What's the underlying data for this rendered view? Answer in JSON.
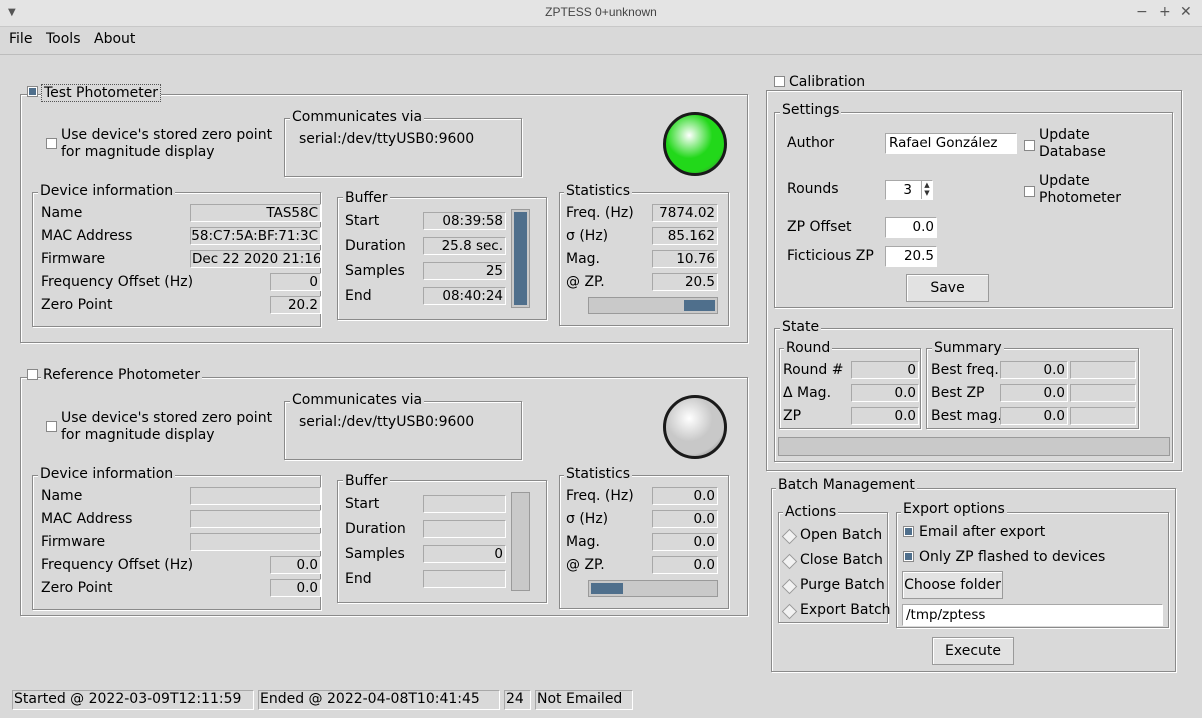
{
  "window": {
    "title": "ZPTESS 0+unknown",
    "controls": [
      "−",
      "+",
      "✕"
    ]
  },
  "menu": {
    "file": "File",
    "tools": "Tools",
    "about": "About"
  },
  "test": {
    "title": "Test Photometer",
    "use_zp_line1": "Use device's stored zero point",
    "use_zp_line2": "for magnitude display",
    "comm_title": "Communicates via",
    "comm_value": "serial:/dev/ttyUSB0:9600",
    "led_color": "#22d81a",
    "devinfo": {
      "title": "Device information",
      "name_label": "Name",
      "name": "TAS58C",
      "mac_label": "MAC Address",
      "mac": "58:C7:5A:BF:71:3C",
      "fw_label": "Firmware",
      "fw": "Dec 22 2020  21:16:",
      "freq_label": "Frequency Offset (Hz)",
      "freq_offset": "0",
      "zp_label": "Zero Point",
      "zp": "20.2"
    },
    "buffer": {
      "title": "Buffer",
      "start_label": "Start",
      "start": "08:39:58",
      "duration_label": "Duration",
      "duration": "25.8 sec.",
      "samples_label": "Samples",
      "samples": "25",
      "end_label": "End",
      "end": "08:40:24",
      "fill": 1.0
    },
    "stats": {
      "title": "Statistics",
      "freq_label": "Freq. (Hz)",
      "freq": "7874.02",
      "sigma_label": "σ (Hz)",
      "sigma": "85.162",
      "mag_label": "Mag.",
      "mag": "10.76",
      "zp_label": "@ ZP.",
      "zp": "20.5",
      "progress": 0.25
    }
  },
  "ref": {
    "title": "Reference Photometer",
    "use_zp_line1": "Use device's stored zero point",
    "use_zp_line2": "for magnitude display",
    "comm_title": "Communicates via",
    "comm_value": "serial:/dev/ttyUSB0:9600",
    "led_color": "#c8c8c8",
    "devinfo": {
      "title": "Device information",
      "name_label": "Name",
      "name": "",
      "mac_label": "MAC Address",
      "mac": "",
      "fw_label": "Firmware",
      "fw": "",
      "freq_label": "Frequency Offset (Hz)",
      "freq_offset": "0.0",
      "zp_label": "Zero Point",
      "zp": "0.0"
    },
    "buffer": {
      "title": "Buffer",
      "start_label": "Start",
      "start": "",
      "duration_label": "Duration",
      "duration": "",
      "samples_label": "Samples",
      "samples": "0",
      "end_label": "End",
      "end": "",
      "fill": 0.0
    },
    "stats": {
      "title": "Statistics",
      "freq_label": "Freq. (Hz)",
      "freq": "0.0",
      "sigma_label": "σ (Hz)",
      "sigma": "0.0",
      "mag_label": "Mag.",
      "mag": "0.0",
      "zp_label": "@ ZP.",
      "zp": "0.0",
      "progress": 0.25
    }
  },
  "calibration": {
    "title": "Calibration",
    "settings": {
      "title": "Settings",
      "author_label": "Author",
      "author": "Rafael González",
      "update_db_line1": "Update",
      "update_db_line2": "Database",
      "rounds_label": "Rounds",
      "rounds": "3",
      "update_ph_line1": "Update",
      "update_ph_line2": "Photometer",
      "zp_offset_label": "ZP Offset",
      "zp_offset": "0.0",
      "ficticious_label": "Ficticious ZP",
      "ficticious": "20.5",
      "save": "Save"
    },
    "state": {
      "title": "State",
      "round": {
        "title": "Round",
        "round_label": "Round #",
        "round": "0",
        "dmag_label": "Δ Mag.",
        "dmag": "0.0",
        "zp_label": "ZP",
        "zp": "0.0"
      },
      "summary": {
        "title": "Summary",
        "best_freq_label": "Best freq.",
        "best_freq": "0.0",
        "best_freq_extra": "",
        "best_zp_label": "Best ZP",
        "best_zp": "0.0",
        "best_zp_extra": "",
        "best_mag_label": "Best mag.",
        "best_mag": "0.0",
        "best_mag_extra": ""
      },
      "progress": 0.0
    }
  },
  "batch": {
    "title": "Batch Management",
    "actions": {
      "title": "Actions",
      "open": "Open Batch",
      "close": "Close Batch",
      "purge": "Purge Batch",
      "export": "Export Batch"
    },
    "export": {
      "title": "Export options",
      "email": "Email after export",
      "only_zp": "Only ZP flashed to devices",
      "choose_folder": "Choose folder",
      "folder": "/tmp/zptess"
    },
    "execute": "Execute"
  },
  "status": {
    "started": "Started @ 2022-03-09T12:11:59",
    "ended": "Ended @ 2022-04-08T10:41:45",
    "count": "24",
    "emailed": "Not Emailed"
  }
}
